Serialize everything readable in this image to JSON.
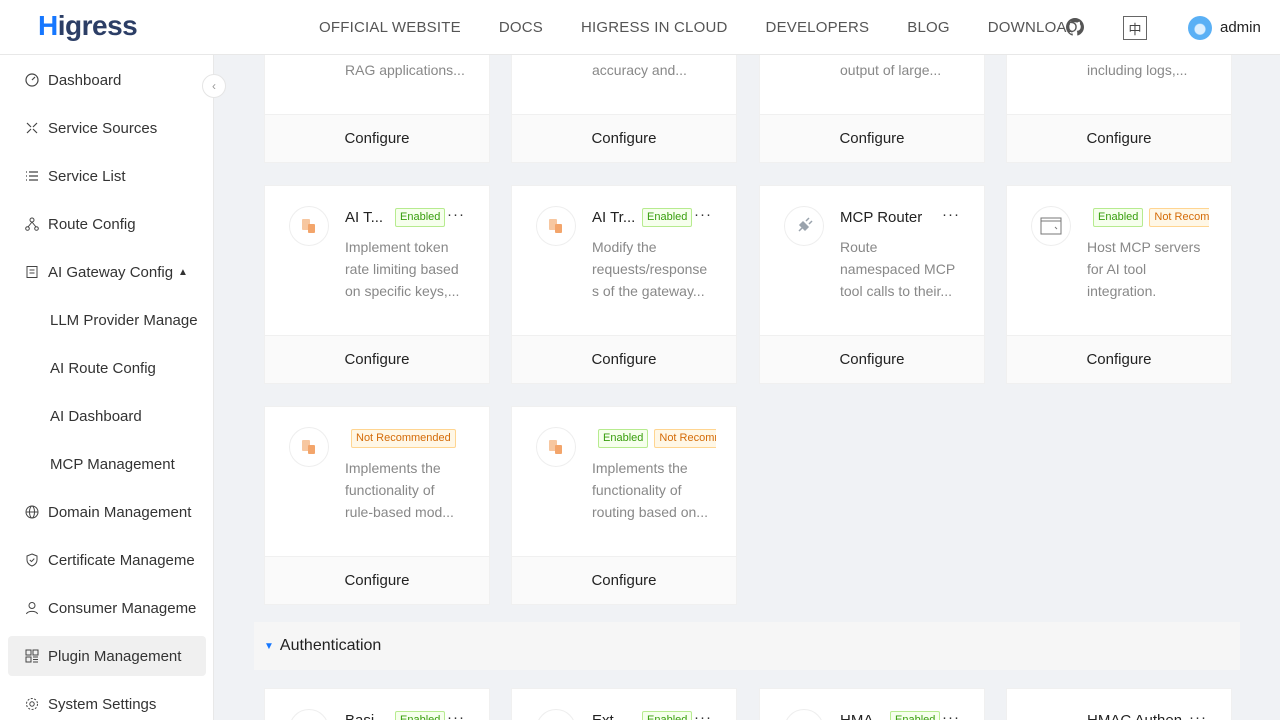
{
  "header": {
    "logo": "Higress",
    "nav": [
      "OFFICIAL WEBSITE",
      "DOCS",
      "HIGRESS IN CLOUD",
      "DEVELOPERS",
      "BLOG",
      "DOWNLOAD"
    ],
    "lang": "中",
    "user": "admin"
  },
  "sidebar": {
    "items": [
      {
        "label": "Dashboard",
        "icon": "dashboard-icon"
      },
      {
        "label": "Service Sources",
        "icon": "service-sources-icon"
      },
      {
        "label": "Service List",
        "icon": "list-icon"
      },
      {
        "label": "Route Config",
        "icon": "route-icon"
      },
      {
        "label": "AI Gateway Config",
        "icon": "ai-gateway-icon"
      },
      {
        "label": "LLM Provider Manage"
      },
      {
        "label": "AI Route Config"
      },
      {
        "label": "AI Dashboard"
      },
      {
        "label": "MCP Management"
      },
      {
        "label": "Domain Management",
        "icon": "globe-icon"
      },
      {
        "label": "Certificate Manageme",
        "icon": "shield-icon"
      },
      {
        "label": "Consumer Manageme",
        "icon": "user-icon"
      },
      {
        "label": "Plugin Management",
        "icon": "plugin-icon"
      },
      {
        "label": "System Settings",
        "icon": "gear-icon"
      }
    ]
  },
  "cards_top": [
    {
      "desc": "RAG applications...",
      "configure": "Configure"
    },
    {
      "desc": "accuracy and...",
      "configure": "Configure"
    },
    {
      "desc": "output of large...",
      "configure": "Configure"
    },
    {
      "desc": "including logs,...",
      "configure": "Configure"
    }
  ],
  "cards_row2": [
    {
      "title": "AI T...",
      "badges": [
        "Enabled"
      ],
      "desc": [
        "Implement token",
        "rate limiting based",
        "on specific keys,..."
      ],
      "configure": "Configure"
    },
    {
      "title": "AI Tr...",
      "badges": [
        "Enabled"
      ],
      "desc": [
        "Modify the",
        "requests/response",
        "s of the gateway..."
      ],
      "configure": "Configure"
    },
    {
      "title": "MCP Router",
      "badges": [],
      "desc": [
        "Route",
        "namespaced MCP",
        "tool calls to their..."
      ],
      "configure": "Configure"
    },
    {
      "title": "",
      "badges": [
        "Enabled",
        "Not Recommended"
      ],
      "desc": [
        "Host MCP servers",
        "for AI tool",
        "integration."
      ],
      "configure": "Configure"
    }
  ],
  "cards_row3": [
    {
      "title": "",
      "badges": [
        "Not Recommended"
      ],
      "desc": [
        "Implements the",
        "functionality of",
        "rule-based mod..."
      ],
      "configure": "Configure"
    },
    {
      "title": "",
      "badges": [
        "Enabled",
        "Not Recommended"
      ],
      "desc": [
        "Implements the",
        "functionality of",
        "routing based on..."
      ],
      "configure": "Configure"
    }
  ],
  "section": {
    "label": "Authentication"
  },
  "cards_auth": [
    {
      "title": "Basi...",
      "badges": [
        "Enabled"
      ]
    },
    {
      "title": "Ext...",
      "badges": [
        "Enabled"
      ]
    },
    {
      "title": "HMA...",
      "badges": [
        "Enabled"
      ]
    },
    {
      "title": "HMAC Authen...",
      "badges": []
    }
  ],
  "more": "···"
}
